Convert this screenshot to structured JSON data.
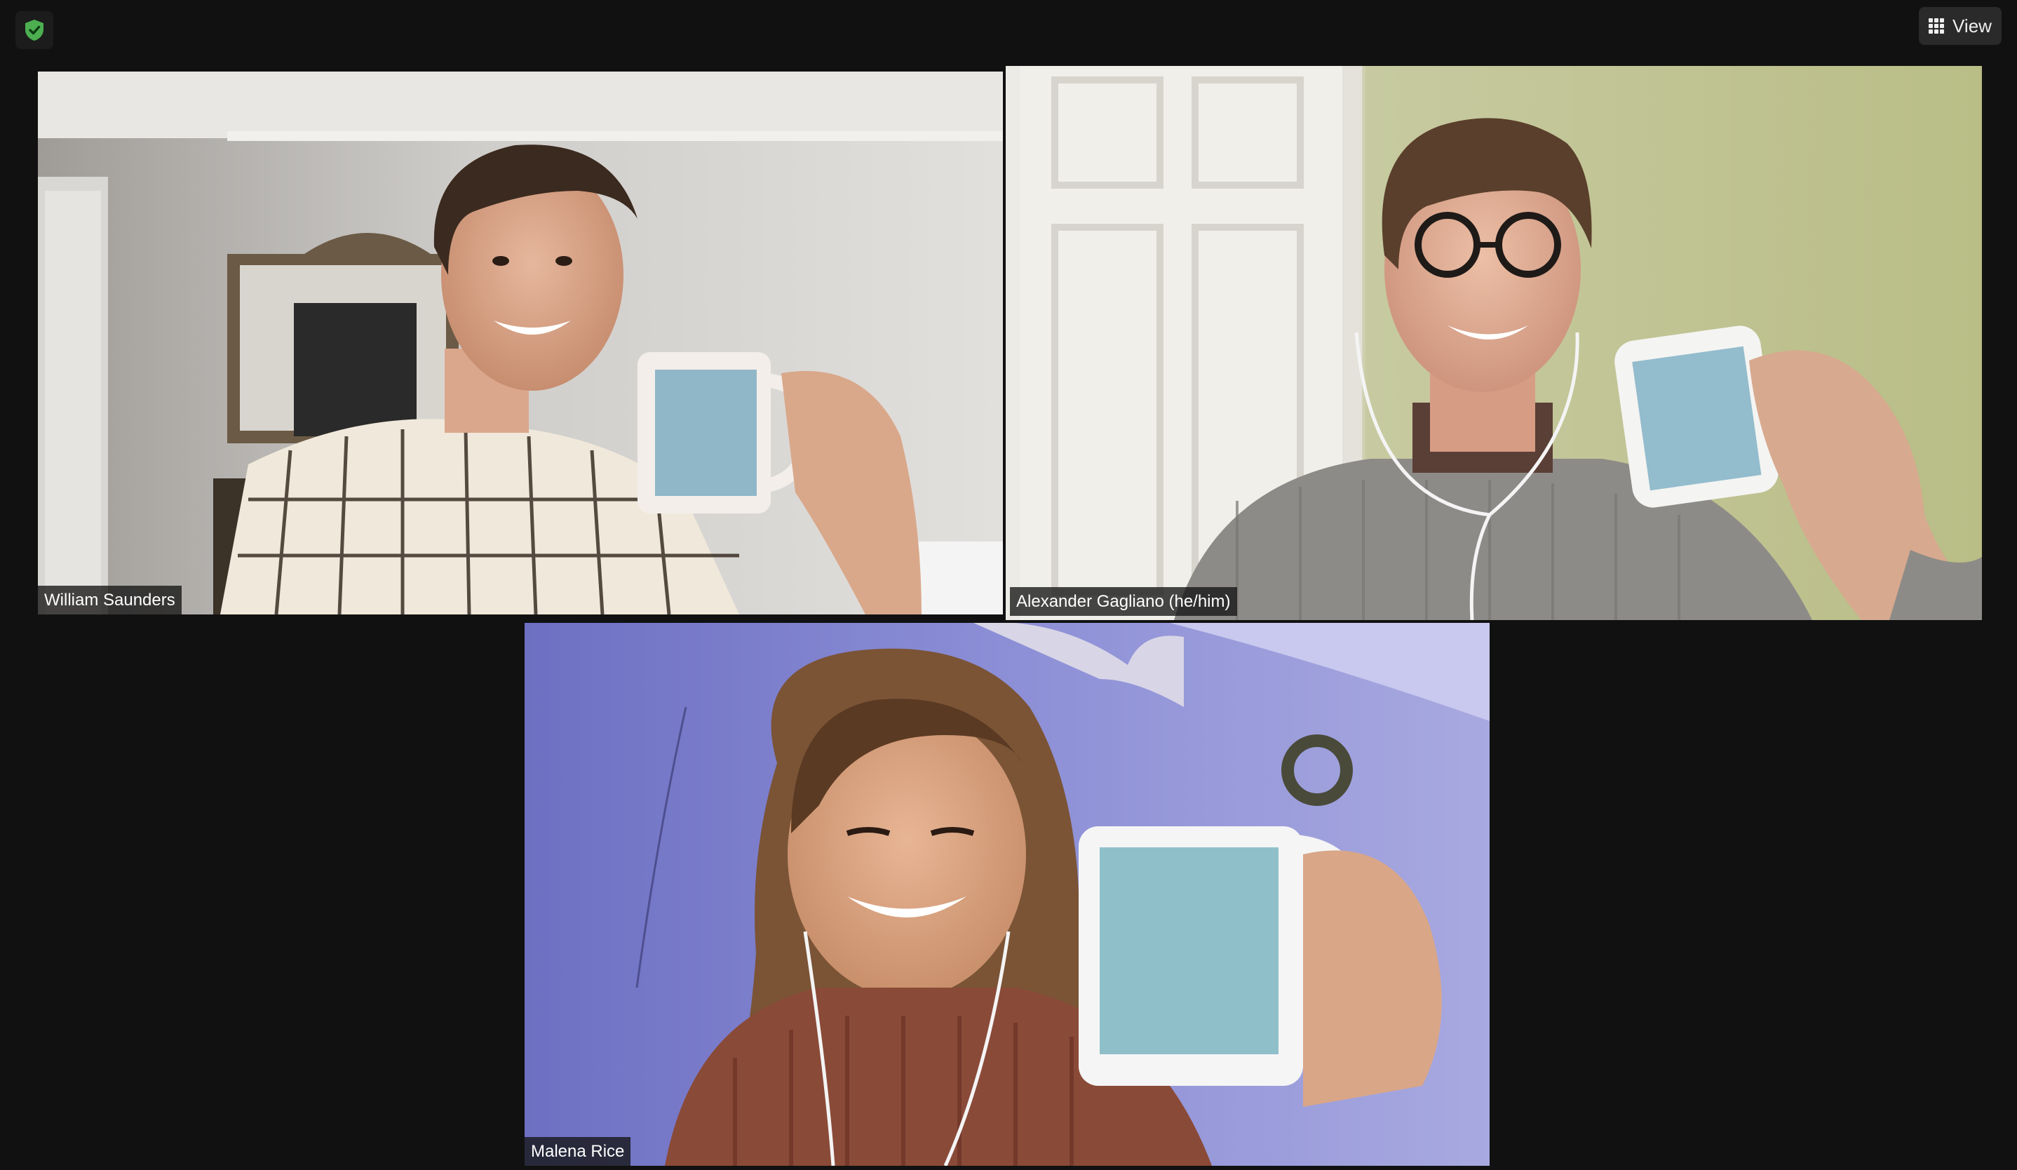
{
  "toolbar": {
    "security_icon": "shield-check-icon",
    "view_icon": "grid-icon",
    "view_label": "View"
  },
  "participants": [
    {
      "name": "William Saunders",
      "active_speaker": false
    },
    {
      "name": "Alexander Gagliano (he/him)",
      "active_speaker": true
    },
    {
      "name": "Malena Rice",
      "active_speaker": false
    }
  ],
  "colors": {
    "background": "#111111",
    "active_border": "#d8e98a",
    "shield": "#4caf50"
  }
}
